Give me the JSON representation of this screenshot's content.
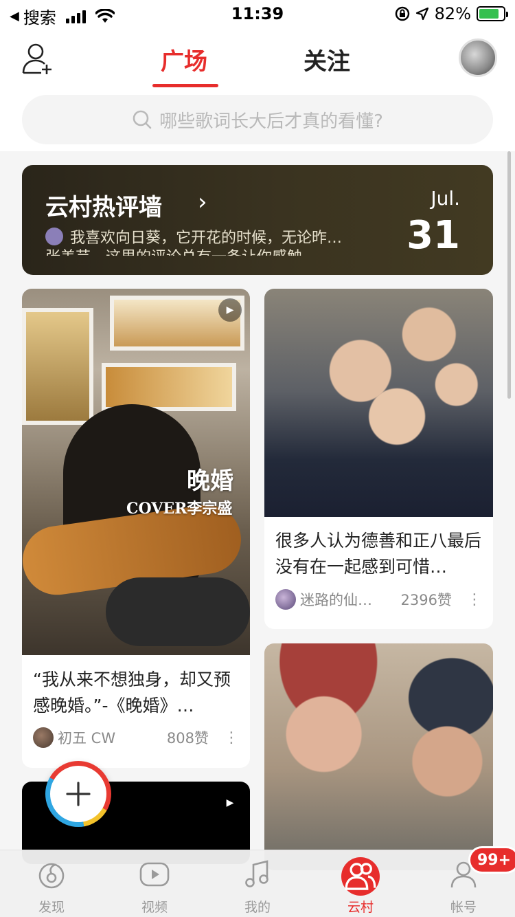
{
  "status_bar": {
    "back_app": "搜索",
    "time": "11:39",
    "battery": "82%",
    "battery_level": 0.82
  },
  "header": {
    "tabs": [
      {
        "label": "广场",
        "active": true
      },
      {
        "label": "关注",
        "active": false
      }
    ],
    "search_placeholder": "哪些歌词长大后才真的看懂?"
  },
  "banner": {
    "title": "云村热评墙",
    "line1": "我喜欢向日葵，它开花的时候，无论昨…",
    "line2": "张美芸　这里的评论总有一条让你感触",
    "month": "Jul.",
    "day": "31"
  },
  "cards": [
    {
      "overlay_title": "晚婚",
      "overlay_subtitle": "COVER李宗盛",
      "title": "“我从来不想独身，却又预感晚婚。”-《晚婚》…",
      "author": "初五 CW",
      "likes": "808赞"
    },
    {
      "title": "很多人认为德善和正八最后没有在一起感到可惜…",
      "author": "迷路的仙…",
      "likes": "2396赞"
    }
  ],
  "tabbar": [
    {
      "label": "发现",
      "icon": "discover-icon"
    },
    {
      "label": "视频",
      "icon": "video-icon"
    },
    {
      "label": "我的",
      "icon": "music-note-icon"
    },
    {
      "label": "云村",
      "icon": "community-icon",
      "active": true
    },
    {
      "label": "帐号",
      "icon": "account-icon",
      "badge": "99+"
    }
  ],
  "colors": {
    "accent": "#e72d2c",
    "background": "#f5f5f5"
  }
}
